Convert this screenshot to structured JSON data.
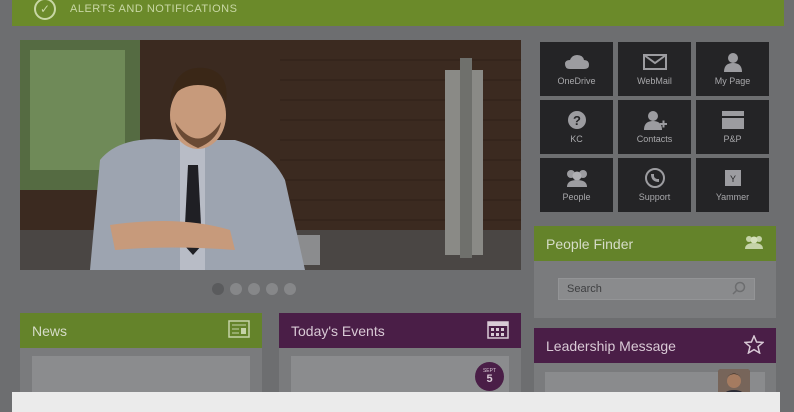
{
  "alerts": {
    "title": "ALERTS AND NOTIFICATIONS",
    "icon": "check-circle-icon"
  },
  "carousel": {
    "slides": 5,
    "active": 1
  },
  "quick_links": [
    {
      "label": "OneDrive",
      "icon": "cloud-icon"
    },
    {
      "label": "WebMail",
      "icon": "envelope-icon"
    },
    {
      "label": "My Page",
      "icon": "person-icon"
    },
    {
      "label": "KC",
      "icon": "question-icon"
    },
    {
      "label": "Contacts",
      "icon": "add-contact-icon"
    },
    {
      "label": "P&P",
      "icon": "folder-icon"
    },
    {
      "label": "People",
      "icon": "group-icon"
    },
    {
      "label": "Support",
      "icon": "phone-icon"
    },
    {
      "label": "Yammer",
      "icon": "yammer-icon"
    }
  ],
  "people_finder": {
    "title": "People Finder",
    "search_placeholder": "Search"
  },
  "leadership": {
    "title": "Leadership Message"
  },
  "news": {
    "title": "News"
  },
  "events": {
    "title": "Today's Events",
    "badge_month": "SEPT",
    "badge_day": "5"
  },
  "colors": {
    "green": "#64832a",
    "purple": "#4a1e47",
    "tile": "#242426"
  }
}
